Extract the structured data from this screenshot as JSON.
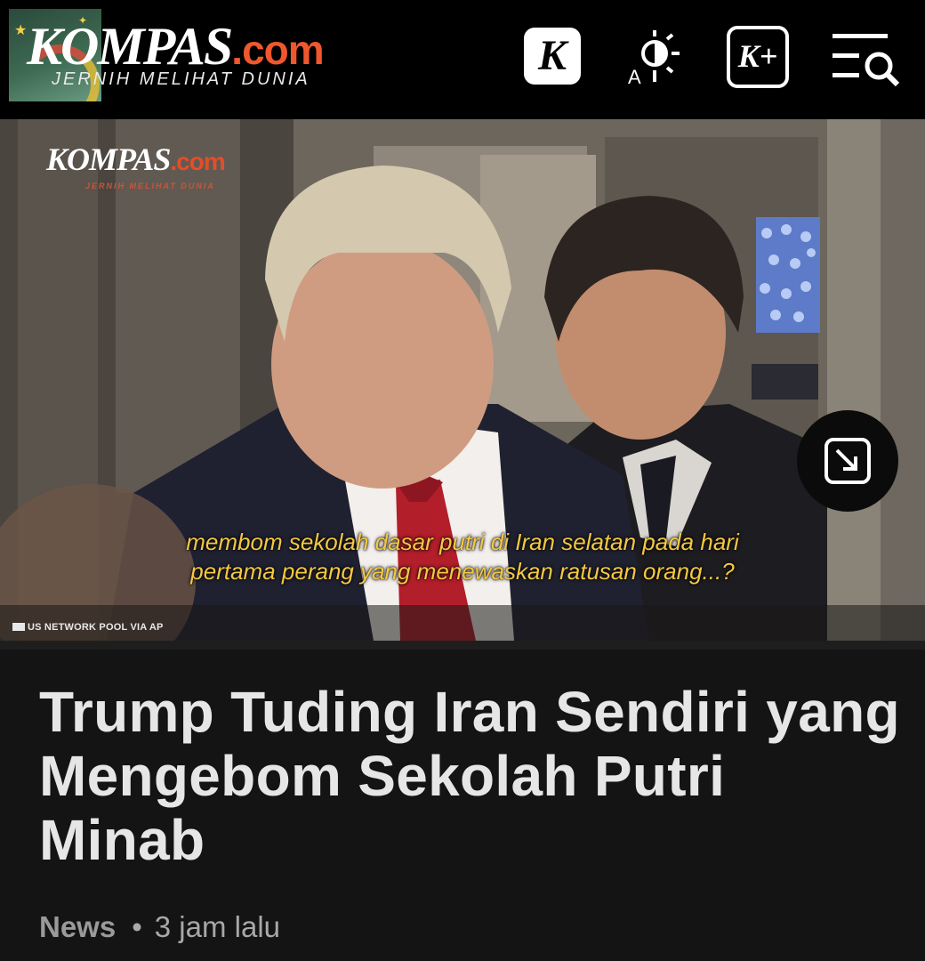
{
  "header": {
    "logo_main": "KOMPAS",
    "logo_suffix": ".com",
    "tagline": "JERNIH MELIHAT DUNIA",
    "k_badge": "K",
    "kplus_label": "K+",
    "icons": [
      "k-badge-icon",
      "theme-toggle-icon",
      "kplus-icon",
      "menu-search-icon"
    ],
    "colors": {
      "background": "#000000",
      "brand_accent": "#f0572d"
    }
  },
  "video": {
    "watermark_main": "KOMPAS",
    "watermark_suffix": ".com",
    "watermark_tagline": "JERNIH MELIHAT DUNIA",
    "subtitle_line1": "membom sekolah dasar putri di Iran selatan pada hari",
    "subtitle_line2": "pertama perang yang menewaskan ratusan orang...?",
    "credit": "US NETWORK POOL VIA AP",
    "expand_icon": "expand-pip-icon",
    "subtitle_color": "#f4c842"
  },
  "article": {
    "headline": "Trump Tuding Iran Sendiri yang Mengebom Sekolah Putri Minab",
    "category": "News",
    "separator": "•",
    "time": "3 jam lalu"
  }
}
